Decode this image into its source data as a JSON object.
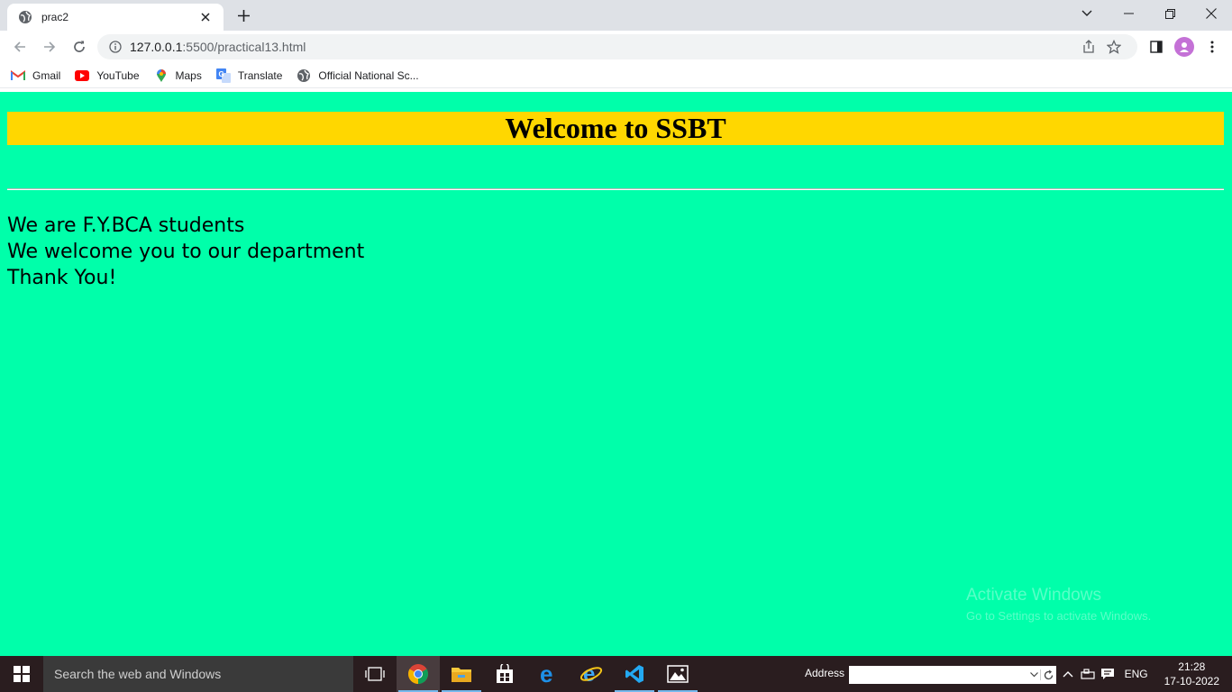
{
  "browser": {
    "tab": {
      "title": "prac2"
    },
    "url_host": "127.0.0.1",
    "url_path": ":5500/practical13.html",
    "bookmarks": [
      {
        "label": "Gmail",
        "icon": "gmail-icon"
      },
      {
        "label": "YouTube",
        "icon": "youtube-icon"
      },
      {
        "label": "Maps",
        "icon": "maps-icon"
      },
      {
        "label": "Translate",
        "icon": "translate-icon"
      },
      {
        "label": "Official National Sc...",
        "icon": "globe-icon"
      }
    ]
  },
  "page": {
    "heading": "Welcome to SSBT",
    "lines": [
      "We are F.Y.BCA students",
      "We welcome you to our department",
      "Thank You!"
    ],
    "colors": {
      "background": "#00ffaa",
      "heading_bg": "#ffd700"
    }
  },
  "watermark": {
    "line1": "Activate Windows",
    "line2": "Go to Settings to activate Windows."
  },
  "taskbar": {
    "search_placeholder": "Search the web and Windows",
    "address_label": "Address",
    "language": "ENG",
    "time": "21:28",
    "date": "17-10-2022"
  }
}
